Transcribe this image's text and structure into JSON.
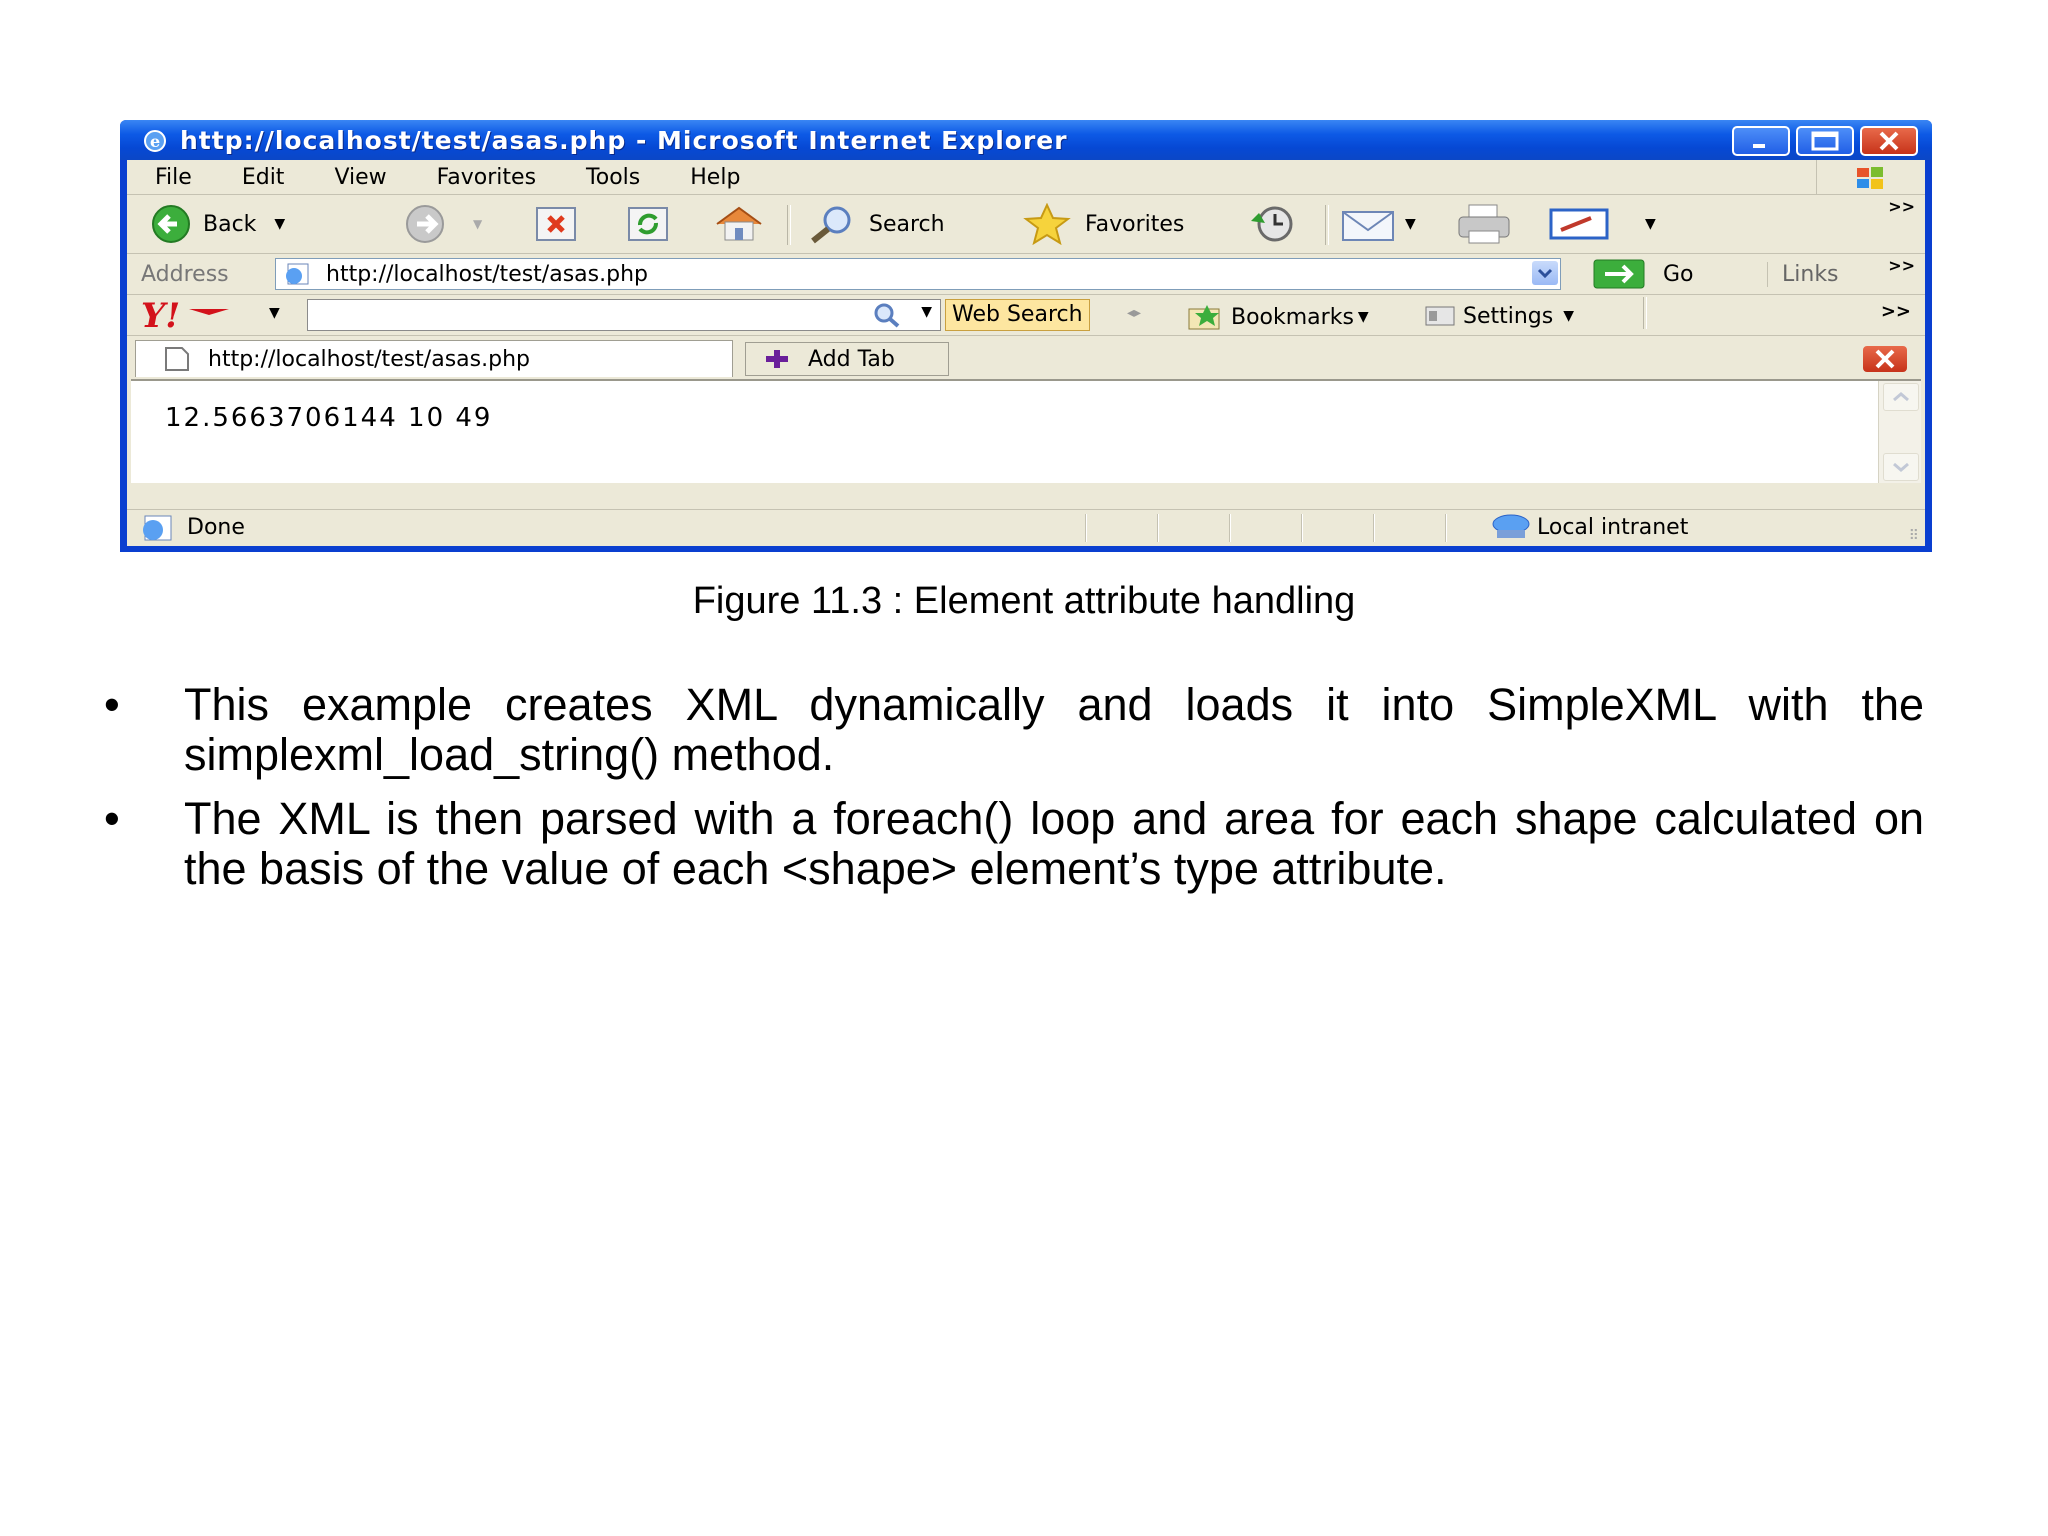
{
  "browser": {
    "title": "http://localhost/test/asas.php - Microsoft Internet Explorer",
    "menu": [
      "File",
      "Edit",
      "View",
      "Favorites",
      "Tools",
      "Help"
    ],
    "toolbar": {
      "back": "Back",
      "search": "Search",
      "favorites": "Favorites",
      "more": ">>"
    },
    "address": {
      "label": "Address",
      "url": "http://localhost/test/asas.php",
      "go": "Go",
      "links": "Links",
      "more": ">>"
    },
    "yahoo": {
      "web_search": "Web Search",
      "bookmarks": "Bookmarks",
      "settings": "Settings",
      "more": ">>"
    },
    "tabs": {
      "active": "http://localhost/test/asas.php",
      "add": "Add Tab"
    },
    "content": "12.5663706144 10 49",
    "status": {
      "left": "Done",
      "zone": "Local intranet"
    }
  },
  "caption": "Figure 11.3 : Element attribute handling",
  "bullets": [
    "This example creates XML dynamically and loads it into SimpleXML with the simplexml_load_string() method.",
    "The XML is then parsed with a foreach() loop and area for each shape calculated on the basis of the value of each <shape> element’s type attribute."
  ],
  "bullet_glyph": "•",
  "icons": [
    "ie-icon",
    "minimize-icon",
    "maximize-icon",
    "close-icon",
    "windows-logo-icon",
    "back-arrow-icon",
    "forward-arrow-icon",
    "stop-icon",
    "refresh-icon",
    "home-icon",
    "search-icon",
    "favorites-star-icon",
    "history-icon",
    "mail-icon",
    "print-icon",
    "edit-icon",
    "page-icon",
    "go-arrow-icon",
    "yahoo-logo-icon",
    "bookmark-icon",
    "settings-icon",
    "add-tab-plus-icon",
    "intranet-icon"
  ]
}
